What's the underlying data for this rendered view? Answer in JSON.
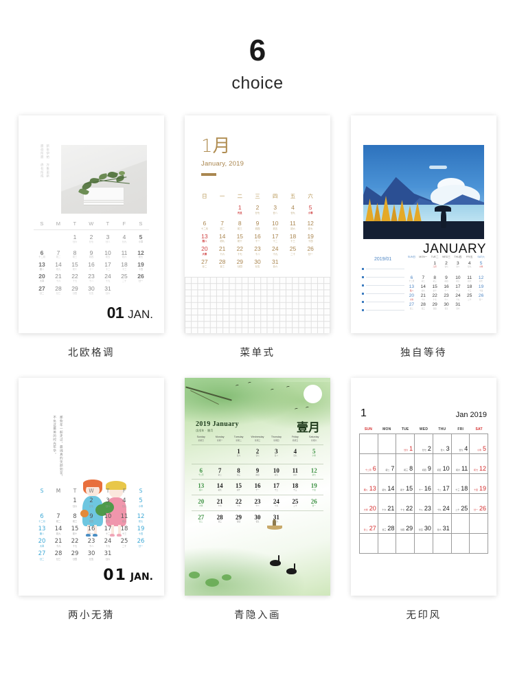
{
  "header": {
    "count": "6",
    "label": "choice"
  },
  "cards": [
    {
      "caption": "北欧格调",
      "vertical_text": "新年伊始 万象更新 愿你所愿 终有所成",
      "weekdays": [
        "S",
        "M",
        "T",
        "W",
        "T",
        "F",
        "S"
      ],
      "footer_month": "01",
      "footer_label": "JAN.",
      "days": [
        [
          null,
          null,
          {
            "n": "1",
            "l": "廿六"
          },
          {
            "n": "2",
            "l": "廿七"
          },
          {
            "n": "3",
            "l": "廿八"
          },
          {
            "n": "4",
            "l": "廿九"
          },
          {
            "n": "5",
            "l": "小寒",
            "hl": true
          }
        ],
        [
          {
            "n": "6",
            "l": "十二月",
            "hl": true
          },
          {
            "n": "7",
            "l": "初二"
          },
          {
            "n": "8",
            "l": "初三"
          },
          {
            "n": "9",
            "l": "初四"
          },
          {
            "n": "10",
            "l": "初五"
          },
          {
            "n": "11",
            "l": "初六"
          },
          {
            "n": "12",
            "l": "初七",
            "hl": true
          }
        ],
        [
          {
            "n": "13",
            "l": "腊八",
            "hl": true
          },
          {
            "n": "14",
            "l": "初九"
          },
          {
            "n": "15",
            "l": "初十"
          },
          {
            "n": "16",
            "l": "十一"
          },
          {
            "n": "17",
            "l": "十二"
          },
          {
            "n": "18",
            "l": "十三"
          },
          {
            "n": "19",
            "l": "十四",
            "hl": true
          }
        ],
        [
          {
            "n": "20",
            "l": "大寒",
            "hl": true
          },
          {
            "n": "21",
            "l": "十六"
          },
          {
            "n": "22",
            "l": "十七"
          },
          {
            "n": "23",
            "l": "十八"
          },
          {
            "n": "24",
            "l": "十九"
          },
          {
            "n": "25",
            "l": "二十"
          },
          {
            "n": "26",
            "l": "廿一",
            "hl": true
          }
        ],
        [
          {
            "n": "27",
            "l": "廿二",
            "hl": true
          },
          {
            "n": "28",
            "l": "廿三"
          },
          {
            "n": "29",
            "l": "廿四"
          },
          {
            "n": "30",
            "l": "廿五"
          },
          {
            "n": "31",
            "l": "廿六"
          },
          null,
          null
        ]
      ]
    },
    {
      "caption": "菜单式",
      "title_zh": "1月",
      "title_en": "January, 2019",
      "weekdays": [
        "日",
        "一",
        "二",
        "三",
        "四",
        "五",
        "六"
      ],
      "days": [
        [
          null,
          null,
          {
            "n": "1",
            "l": "元旦",
            "red": true
          },
          {
            "n": "2",
            "l": "廿七"
          },
          {
            "n": "3",
            "l": "廿八"
          },
          {
            "n": "4",
            "l": "廿九"
          },
          {
            "n": "5",
            "l": "小寒",
            "red": true
          }
        ],
        [
          {
            "n": "6",
            "l": "十二月"
          },
          {
            "n": "7",
            "l": "初二"
          },
          {
            "n": "8",
            "l": "初三"
          },
          {
            "n": "9",
            "l": "初四"
          },
          {
            "n": "10",
            "l": "初五"
          },
          {
            "n": "11",
            "l": "初六"
          },
          {
            "n": "12",
            "l": "初七"
          }
        ],
        [
          {
            "n": "13",
            "l": "腊八",
            "red": true
          },
          {
            "n": "14",
            "l": "初九"
          },
          {
            "n": "15",
            "l": "初十"
          },
          {
            "n": "16",
            "l": "十一"
          },
          {
            "n": "17",
            "l": "十二"
          },
          {
            "n": "18",
            "l": "十三"
          },
          {
            "n": "19",
            "l": "十四"
          }
        ],
        [
          {
            "n": "20",
            "l": "大寒",
            "red": true
          },
          {
            "n": "21",
            "l": "十六"
          },
          {
            "n": "22",
            "l": "十七"
          },
          {
            "n": "23",
            "l": "十八"
          },
          {
            "n": "24",
            "l": "十九"
          },
          {
            "n": "25",
            "l": "二十"
          },
          {
            "n": "26",
            "l": "廿一"
          }
        ],
        [
          {
            "n": "27",
            "l": "廿二"
          },
          {
            "n": "28",
            "l": "廿三"
          },
          {
            "n": "29",
            "l": "廿四"
          },
          {
            "n": "30",
            "l": "廿五"
          },
          {
            "n": "31",
            "l": "廿六"
          },
          null,
          null
        ]
      ]
    },
    {
      "caption": "独自等待",
      "month_en": "JANUARY",
      "year_month": "2019/01",
      "weekdays": [
        "SUN日",
        "MON一",
        "TUE二",
        "WED三",
        "THU四",
        "FRI五",
        "SAT六"
      ],
      "note_lines": 6,
      "days": [
        [
          null,
          null,
          {
            "n": "1",
            "l": "元旦",
            "red": true
          },
          {
            "n": "2",
            "l": "廿七"
          },
          {
            "n": "3",
            "l": "廿八"
          },
          {
            "n": "4",
            "l": "廿九"
          },
          {
            "n": "5",
            "l": "小寒",
            "red": true
          }
        ],
        [
          {
            "n": "6",
            "l": "十二月"
          },
          {
            "n": "7",
            "l": "初二"
          },
          {
            "n": "8",
            "l": "初三"
          },
          {
            "n": "9",
            "l": "初四"
          },
          {
            "n": "10",
            "l": "初五"
          },
          {
            "n": "11",
            "l": "初六"
          },
          {
            "n": "12",
            "l": "初七"
          }
        ],
        [
          {
            "n": "13",
            "l": "腊八",
            "red": true
          },
          {
            "n": "14",
            "l": "初九"
          },
          {
            "n": "15",
            "l": "初十"
          },
          {
            "n": "16",
            "l": "十一"
          },
          {
            "n": "17",
            "l": "十二"
          },
          {
            "n": "18",
            "l": "十三"
          },
          {
            "n": "19",
            "l": "十四"
          }
        ],
        [
          {
            "n": "20",
            "l": "大寒",
            "red": true
          },
          {
            "n": "21",
            "l": "十六"
          },
          {
            "n": "22",
            "l": "十七"
          },
          {
            "n": "23",
            "l": "十八"
          },
          {
            "n": "24",
            "l": "十九"
          },
          {
            "n": "25",
            "l": "二十"
          },
          {
            "n": "26",
            "l": "廿一"
          }
        ],
        [
          {
            "n": "27",
            "l": "廿二"
          },
          {
            "n": "28",
            "l": "廿三"
          },
          {
            "n": "29",
            "l": "廿四"
          },
          {
            "n": "30",
            "l": "廿五"
          },
          {
            "n": "31",
            "l": "廿六"
          },
          null,
          null
        ]
      ]
    },
    {
      "caption": "两小无猜",
      "vertical_text": "那些年一起走过，最纯真的笑颜如花，不负这最美的时光年华。",
      "weekdays": [
        "S",
        "M",
        "T",
        "W",
        "T",
        "F",
        "S"
      ],
      "footer_month": "01",
      "footer_label": "JAN.",
      "days": [
        [
          null,
          null,
          {
            "n": "1",
            "l": "廿六"
          },
          {
            "n": "2",
            "l": "廿七"
          },
          {
            "n": "3",
            "l": "廿八"
          },
          {
            "n": "4",
            "l": "廿九"
          },
          {
            "n": "5",
            "l": "小寒",
            "blue": true
          }
        ],
        [
          {
            "n": "6",
            "l": "十二月",
            "blue": true
          },
          {
            "n": "7",
            "l": "初二"
          },
          {
            "n": "8",
            "l": "初三"
          },
          {
            "n": "9",
            "l": "初四"
          },
          {
            "n": "10",
            "l": "初五"
          },
          {
            "n": "11",
            "l": "初六"
          },
          {
            "n": "12",
            "l": "初七",
            "blue": true
          }
        ],
        [
          {
            "n": "13",
            "l": "腊八",
            "blue": true
          },
          {
            "n": "14",
            "l": "初九"
          },
          {
            "n": "15",
            "l": "初十"
          },
          {
            "n": "16",
            "l": "十一"
          },
          {
            "n": "17",
            "l": "十二"
          },
          {
            "n": "18",
            "l": "十三"
          },
          {
            "n": "19",
            "l": "十四",
            "blue": true
          }
        ],
        [
          {
            "n": "20",
            "l": "大寒",
            "blue": true
          },
          {
            "n": "21",
            "l": "十六"
          },
          {
            "n": "22",
            "l": "十七"
          },
          {
            "n": "23",
            "l": "十八"
          },
          {
            "n": "24",
            "l": "十九"
          },
          {
            "n": "25",
            "l": "二十"
          },
          {
            "n": "26",
            "l": "廿一",
            "blue": true
          }
        ],
        [
          {
            "n": "27",
            "l": "廿二",
            "blue": true
          },
          {
            "n": "28",
            "l": "廿三"
          },
          {
            "n": "29",
            "l": "廿四"
          },
          {
            "n": "30",
            "l": "廿五"
          },
          {
            "n": "31",
            "l": "廿六"
          },
          null,
          null
        ]
      ]
    },
    {
      "caption": "青隐入画",
      "title_en": "2019  January",
      "title_sub": "戊戌年 · 腊月",
      "title_zh": "壹月",
      "weekdays": [
        {
          "en": "Sunday",
          "zh": "星期日"
        },
        {
          "en": "Monday",
          "zh": "星期一"
        },
        {
          "en": "Tuesday",
          "zh": "星期二"
        },
        {
          "en": "Wednesday",
          "zh": "星期三"
        },
        {
          "en": "Thursday",
          "zh": "星期四"
        },
        {
          "en": "Friday",
          "zh": "星期五"
        },
        {
          "en": "Saturday",
          "zh": "星期六"
        }
      ],
      "days": [
        [
          null,
          null,
          {
            "n": "1",
            "l": "廿六"
          },
          {
            "n": "2",
            "l": "廿七"
          },
          {
            "n": "3",
            "l": "廿八"
          },
          {
            "n": "4",
            "l": "廿九"
          },
          {
            "n": "5",
            "l": "小寒",
            "green": true
          }
        ],
        [
          {
            "n": "6",
            "l": "十二月",
            "green": true
          },
          {
            "n": "7",
            "l": "初二"
          },
          {
            "n": "8",
            "l": "初三"
          },
          {
            "n": "9",
            "l": "初四"
          },
          {
            "n": "10",
            "l": "初五"
          },
          {
            "n": "11",
            "l": "初六"
          },
          {
            "n": "12",
            "l": "初七",
            "green": true
          }
        ],
        [
          {
            "n": "13",
            "l": "腊八",
            "green": true
          },
          {
            "n": "14",
            "l": "初九"
          },
          {
            "n": "15",
            "l": "初十"
          },
          {
            "n": "16",
            "l": "十一"
          },
          {
            "n": "17",
            "l": "十二"
          },
          {
            "n": "18",
            "l": "十三"
          },
          {
            "n": "19",
            "l": "十四",
            "green": true
          }
        ],
        [
          {
            "n": "20",
            "l": "大寒",
            "green": true
          },
          {
            "n": "21",
            "l": "十六"
          },
          {
            "n": "22",
            "l": "十七"
          },
          {
            "n": "23",
            "l": "十八"
          },
          {
            "n": "24",
            "l": "十九"
          },
          {
            "n": "25",
            "l": "二十"
          },
          {
            "n": "26",
            "l": "廿一",
            "green": true
          }
        ],
        [
          {
            "n": "27",
            "l": "廿二",
            "green": true
          },
          {
            "n": "28",
            "l": "廿三"
          },
          {
            "n": "29",
            "l": "廿四"
          },
          {
            "n": "30",
            "l": "廿五"
          },
          {
            "n": "31",
            "l": "廿六"
          },
          null,
          null
        ]
      ]
    },
    {
      "caption": "无印风",
      "month_num": "1",
      "month_label": "Jan 2019",
      "weekdays": [
        "SUN",
        "MON",
        "TUE",
        "WED",
        "THU",
        "FRI",
        "SAT"
      ],
      "days": [
        [
          null,
          null,
          {
            "n": "1",
            "l": "廿六",
            "red": true
          },
          {
            "n": "2",
            "l": "廿七"
          },
          {
            "n": "3",
            "l": "廿八"
          },
          {
            "n": "4",
            "l": "廿九"
          },
          {
            "n": "5",
            "l": "小寒",
            "red": true
          }
        ],
        [
          {
            "n": "6",
            "l": "十二月",
            "red": true
          },
          {
            "n": "7",
            "l": "初二"
          },
          {
            "n": "8",
            "l": "初三"
          },
          {
            "n": "9",
            "l": "初四"
          },
          {
            "n": "10",
            "l": "初五"
          },
          {
            "n": "11",
            "l": "初六"
          },
          {
            "n": "12",
            "l": "初七",
            "red": true
          }
        ],
        [
          {
            "n": "13",
            "l": "腊八",
            "red": true
          },
          {
            "n": "14",
            "l": "初九"
          },
          {
            "n": "15",
            "l": "初十"
          },
          {
            "n": "16",
            "l": "十一"
          },
          {
            "n": "17",
            "l": "十二"
          },
          {
            "n": "18",
            "l": "十三"
          },
          {
            "n": "19",
            "l": "十四",
            "red": true
          }
        ],
        [
          {
            "n": "20",
            "l": "大寒",
            "red": true
          },
          {
            "n": "21",
            "l": "十六"
          },
          {
            "n": "22",
            "l": "十七"
          },
          {
            "n": "23",
            "l": "十八"
          },
          {
            "n": "24",
            "l": "十九"
          },
          {
            "n": "25",
            "l": "二十"
          },
          {
            "n": "26",
            "l": "廿一",
            "red": true
          }
        ],
        [
          {
            "n": "27",
            "l": "廿二",
            "red": true
          },
          {
            "n": "28",
            "l": "廿三"
          },
          {
            "n": "29",
            "l": "廿四"
          },
          {
            "n": "30",
            "l": "廿五"
          },
          {
            "n": "31",
            "l": "廿六"
          },
          null,
          null
        ],
        [
          null,
          null,
          null,
          null,
          null,
          null,
          null
        ]
      ]
    }
  ],
  "colors": {
    "gold": "#a9854f",
    "red": "#cf4040",
    "blue": "#3fa9d6",
    "green": "#3f9245",
    "muji_red": "#d32a2a"
  }
}
